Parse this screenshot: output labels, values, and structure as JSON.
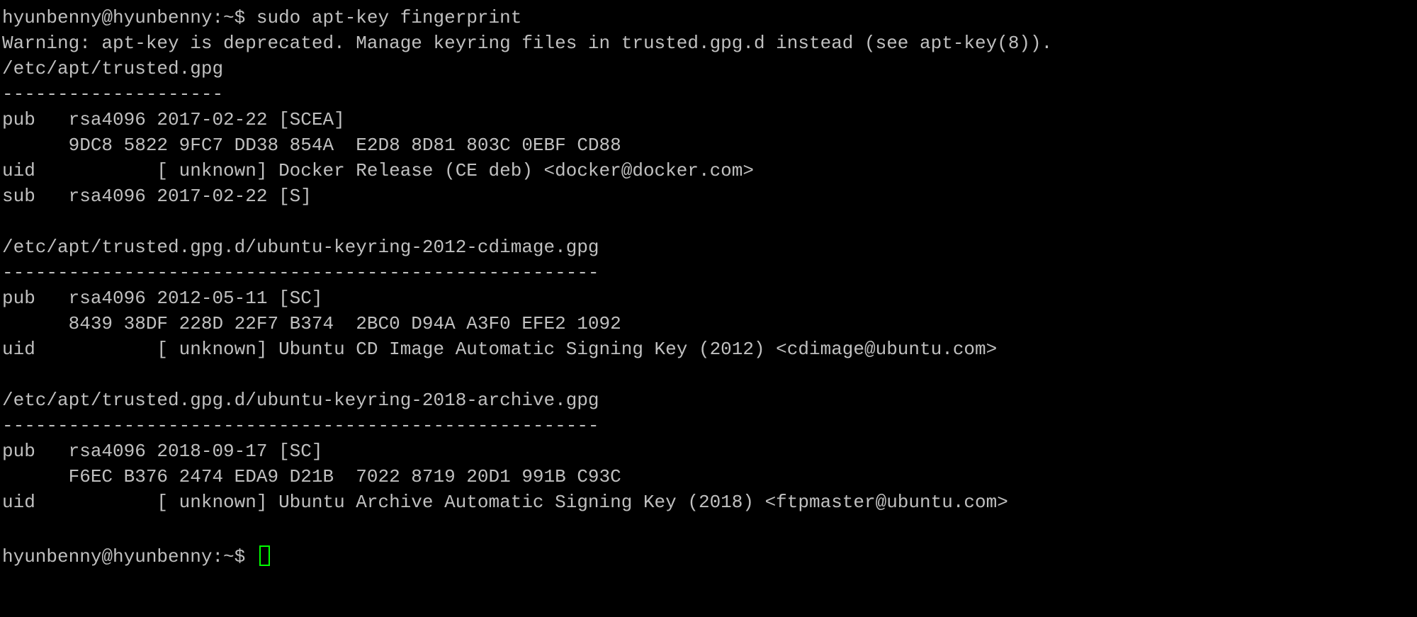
{
  "terminal": {
    "prompt": "hyunbenny@hyunbenny:~$",
    "command": "sudo apt-key fingerprint",
    "warning": "Warning: apt-key is deprecated. Manage keyring files in trusted.gpg.d instead (see apt-key(8)).",
    "keyrings": [
      {
        "path": "/etc/apt/trusted.gpg",
        "separator": "--------------------",
        "pub": "pub   rsa4096 2017-02-22 [SCEA]",
        "fingerprint": "      9DC8 5822 9FC7 DD38 854A  E2D8 8D81 803C 0EBF CD88",
        "uid": "uid           [ unknown] Docker Release (CE deb) <docker@docker.com>",
        "sub": "sub   rsa4096 2017-02-22 [S]"
      },
      {
        "path": "/etc/apt/trusted.gpg.d/ubuntu-keyring-2012-cdimage.gpg",
        "separator": "------------------------------------------------------",
        "pub": "pub   rsa4096 2012-05-11 [SC]",
        "fingerprint": "      8439 38DF 228D 22F7 B374  2BC0 D94A A3F0 EFE2 1092",
        "uid": "uid           [ unknown] Ubuntu CD Image Automatic Signing Key (2012) <cdimage@ubuntu.com>"
      },
      {
        "path": "/etc/apt/trusted.gpg.d/ubuntu-keyring-2018-archive.gpg",
        "separator": "------------------------------------------------------",
        "pub": "pub   rsa4096 2018-09-17 [SC]",
        "fingerprint": "      F6EC B376 2474 EDA9 D21B  7022 8719 20D1 991B C93C",
        "uid": "uid           [ unknown] Ubuntu Archive Automatic Signing Key (2018) <ftpmaster@ubuntu.com>"
      }
    ],
    "colors": {
      "background": "#000000",
      "text": "#c0c0c0",
      "cursor": "#00ff00"
    }
  }
}
